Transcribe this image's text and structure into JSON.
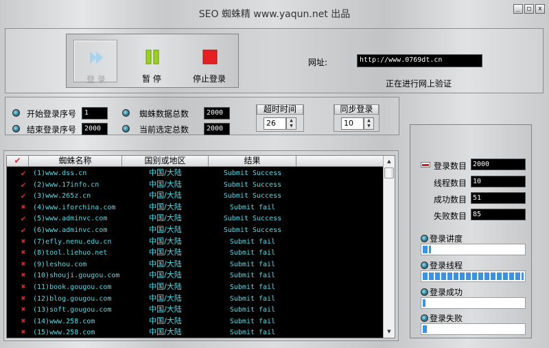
{
  "window": {
    "title": "SEO 蜘蛛精 www.yaqun.net 出品",
    "min": "_",
    "max": "□",
    "close": "x"
  },
  "toolbar": {
    "login": "登 录",
    "pause": "暂 停",
    "stop": "停止登录"
  },
  "url": {
    "label": "网址:",
    "value": "http://www.0769dt.cn",
    "status": "正在进行网上验证"
  },
  "settings": {
    "start_label": "开始登录序号",
    "start_value": "1",
    "end_label": "结束登录序号",
    "end_value": "2000",
    "total_label": "蜘蛛数据总数",
    "total_value": "2000",
    "selected_label": "当前选定总数",
    "selected_value": "2000",
    "timeout_label": "超时时间",
    "timeout_value": "26",
    "sync_label": "同步登录",
    "sync_value": "10"
  },
  "table": {
    "headers": {
      "check": "✔",
      "name": "蜘蛛名称",
      "region": "国别或地区",
      "result": "结果"
    },
    "rows": [
      {
        "ok": true,
        "mark": "✔",
        "name": "(1)www.dss.cn",
        "region": "中国/大陆",
        "result": "Submit Success"
      },
      {
        "ok": true,
        "mark": "✔",
        "name": "(2)www.17info.cn",
        "region": "中国/大陆",
        "result": "Submit Success"
      },
      {
        "ok": true,
        "mark": "✔",
        "name": "(3)www.265z.cn",
        "region": "中国/大陆",
        "result": "Submit Success"
      },
      {
        "ok": false,
        "mark": "✖",
        "name": "(4)www.iforchina.com",
        "region": "中国/大陆",
        "result": "Submit fail"
      },
      {
        "ok": true,
        "mark": "✔",
        "name": "(5)www.adminvc.com",
        "region": "中国/大陆",
        "result": "Submit Success"
      },
      {
        "ok": true,
        "mark": "✔",
        "name": "(6)www.adminvc.com",
        "region": "中国/大陆",
        "result": "Submit Success"
      },
      {
        "ok": false,
        "mark": "✖",
        "name": "(7)efly.nenu.edu.cn",
        "region": "中国/大陆",
        "result": "Submit fail"
      },
      {
        "ok": false,
        "mark": "✖",
        "name": "(8)tool.liehuo.net",
        "region": "中国/大陆",
        "result": "Submit fail"
      },
      {
        "ok": false,
        "mark": "✖",
        "name": "(9)leshou.com",
        "region": "中国/大陆",
        "result": "Submit fail"
      },
      {
        "ok": false,
        "mark": "✖",
        "name": "(10)shouji.gougou.com",
        "region": "中国/大陆",
        "result": "Submit fail"
      },
      {
        "ok": false,
        "mark": "✖",
        "name": "(11)book.gougou.com",
        "region": "中国/大陆",
        "result": "Submit fail"
      },
      {
        "ok": false,
        "mark": "✖",
        "name": "(12)blog.gougou.com",
        "region": "中国/大陆",
        "result": "Submit fail"
      },
      {
        "ok": false,
        "mark": "✖",
        "name": "(13)soft.gougou.com",
        "region": "中国/大陆",
        "result": "Submit fail"
      },
      {
        "ok": false,
        "mark": "✖",
        "name": "(14)www.258.com",
        "region": "中国/大陆",
        "result": "Submit fail"
      },
      {
        "ok": false,
        "mark": "✖",
        "name": "(15)www.258.com",
        "region": "中国/大陆",
        "result": "Submit fail"
      }
    ]
  },
  "stats": {
    "login_count_label": "登录数目",
    "login_count": "2000",
    "threads_label": "线程数目",
    "threads": "10",
    "success_label": "成功数目",
    "success": "51",
    "fail_label": "失败数目",
    "fail": "85",
    "progress_label": "登录讲度",
    "progress_pct": 8,
    "thread_label": "登录线程",
    "thread_pct": 100,
    "success_bar_label": "登录成功",
    "success_pct": 3,
    "fail_bar_label": "登录失败",
    "fail_pct": 4
  },
  "colors": {
    "lcd_bg": "#000000",
    "cyan_text": "#4fe0ea",
    "mark_red": "#e8202a",
    "progress_blue": "#3a92e8"
  }
}
